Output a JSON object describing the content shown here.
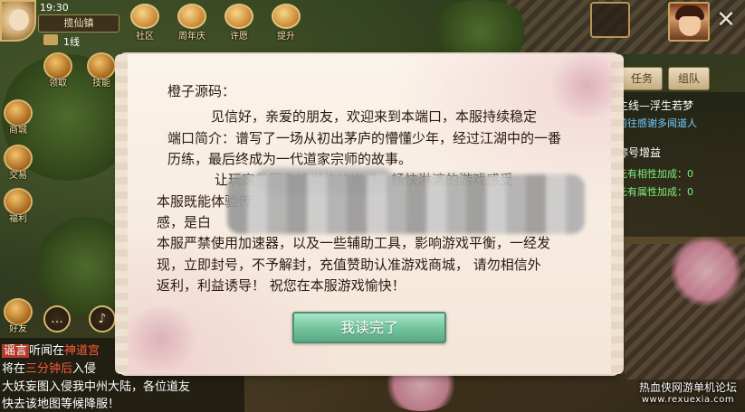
{
  "status": {
    "time": "19:30",
    "server_name": "揽仙镇",
    "line": "1线"
  },
  "top_icons": [
    {
      "id": "guild",
      "label": "社区"
    },
    {
      "id": "anniversary",
      "label": "周年庆"
    },
    {
      "id": "invite",
      "label": "许愿"
    },
    {
      "id": "upgrade",
      "label": "提升"
    }
  ],
  "left_icons": [
    {
      "id": "reward",
      "label": "领取"
    },
    {
      "id": "skill",
      "label": "技能"
    },
    {
      "id": "mall",
      "label": "商城"
    },
    {
      "id": "trade",
      "label": "交易"
    },
    {
      "id": "welfare",
      "label": "福利"
    },
    {
      "id": "friend",
      "label": "好友"
    }
  ],
  "quest": {
    "tabs": [
      "任务",
      "组队"
    ],
    "lines": [
      {
        "text": "主线—浮生若梦",
        "color": "#ffffff"
      },
      {
        "text": "前往感谢多闻道人",
        "color": "#6fd0ff"
      },
      {
        "text": "称号增益",
        "color": "#ffffff"
      },
      {
        "text": "元有相性加成：0",
        "color": "#7df07d"
      },
      {
        "text": "元有属性加成：0",
        "color": "#7df07d"
      }
    ]
  },
  "announcement": {
    "title": "橙子源码：",
    "paragraphs": [
      "见信好，亲爱的朋友，欢迎来到本端口，本服持续稳定",
      "端口简介：谱写了一场从初出茅庐的懵懂少年，经过江湖中的一番",
      "历练，最后终成为一代道家宗师的故事。",
      "让玩家重回激情燃烧的岁月，畅快淋漓的游戏感受",
      "本服既能体验传",
      "感，是白",
      "本服严禁使用加速器，以及一些辅助工具，影响游戏平衡，一经发",
      "现，立即封号，不予解封，充值赞助认准游戏商城， 请勿相信外",
      "返利，利益诱导！ 祝您在本服游戏愉快！"
    ],
    "confirm_button": "我读完了"
  },
  "chat": {
    "lines": [
      {
        "tag": "谣言",
        "parts": [
          "听闻在",
          "神道宫",
          ""
        ]
      },
      {
        "tag": "",
        "parts": [
          "将在",
          "三分钟后",
          "入侵"
        ]
      },
      {
        "tag": "",
        "parts": [
          "大妖妄图入侵我中州大陆，各位道友",
          "",
          ""
        ]
      },
      {
        "tag": "",
        "parts": [
          "快去该地图等候降服！",
          "",
          ""
        ]
      }
    ]
  },
  "watermark": {
    "line1": "热血侠网游单机论坛",
    "line2": "www.rexuexia.com"
  }
}
